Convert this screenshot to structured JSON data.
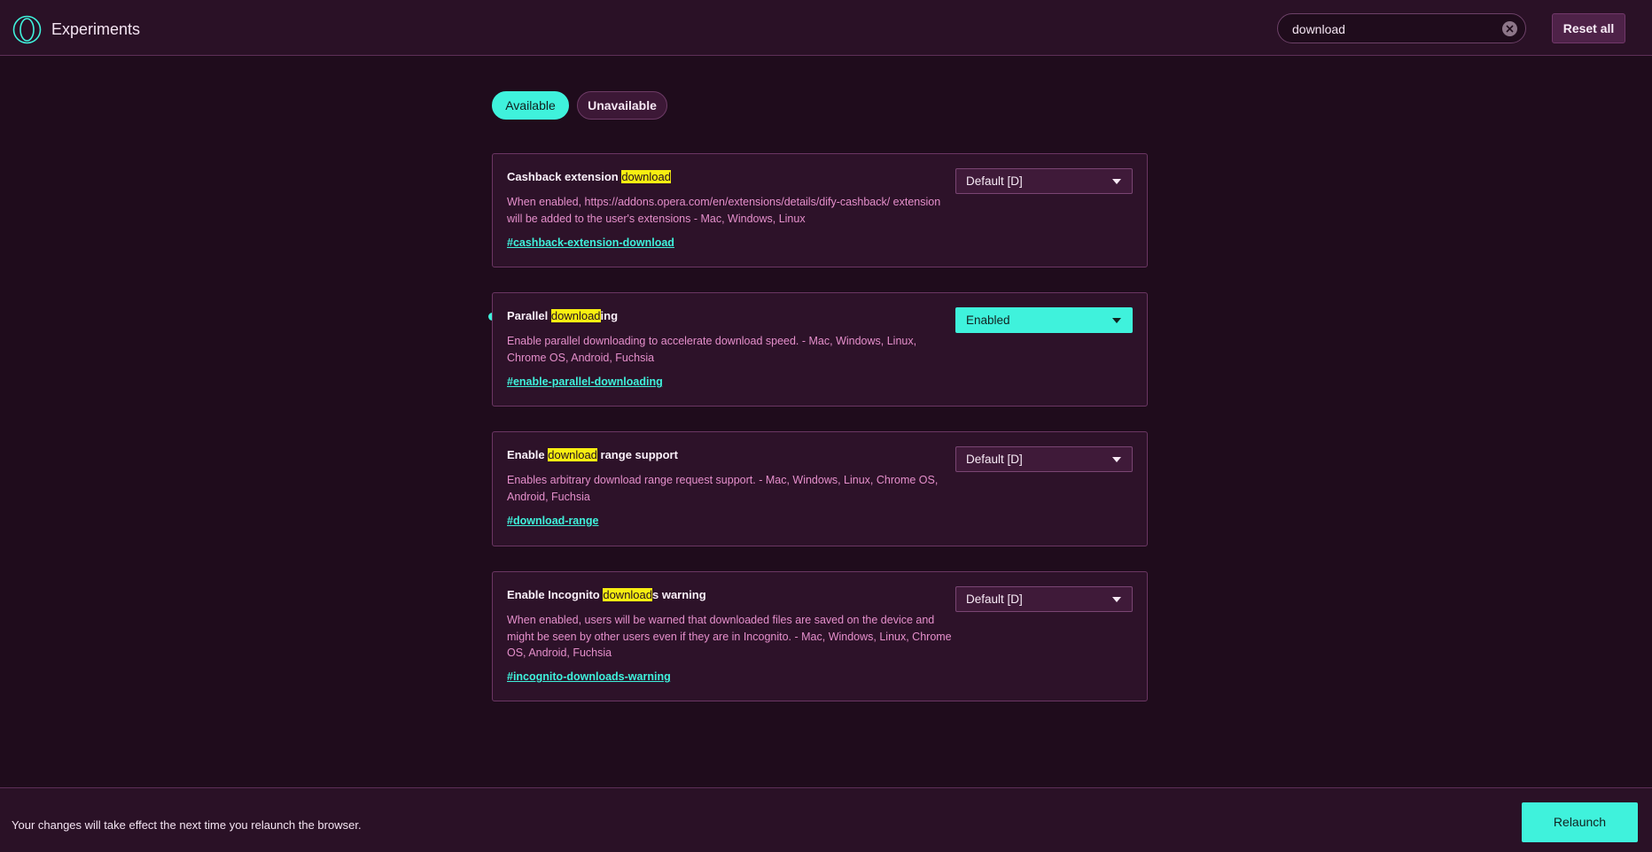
{
  "header": {
    "logo_icon": "opera-logo-icon",
    "title": "Experiments",
    "search": {
      "value": "download",
      "clear_icon": "clear-circle-icon"
    },
    "reset_label": "Reset all"
  },
  "tabs": [
    {
      "label": "Available",
      "active": true
    },
    {
      "label": "Unavailable",
      "active": false
    }
  ],
  "experiments": [
    {
      "title_before": "Cashback extension ",
      "title_match": "download",
      "title_after": "",
      "description": "When enabled, https://addons.opera.com/en/extensions/details/dify-cashback/ extension will be added to the user's extensions - Mac, Windows, Linux",
      "link": "#cashback-extension-download",
      "selected": "Default [D]",
      "modified": false
    },
    {
      "title_before": "Parallel ",
      "title_match": "download",
      "title_after": "ing",
      "description": "Enable parallel downloading to accelerate download speed. - Mac, Windows, Linux, Chrome OS, Android, Fuchsia",
      "link": "#enable-parallel-downloading",
      "selected": "Enabled",
      "modified": true
    },
    {
      "title_before": "Enable ",
      "title_match": "download",
      "title_after": " range support",
      "description": "Enables arbitrary download range request support. - Mac, Windows, Linux, Chrome OS, Android, Fuchsia",
      "link": "#download-range",
      "selected": "Default [D]",
      "modified": false
    },
    {
      "title_before": "Enable Incognito ",
      "title_match": "download",
      "title_after": "s warning",
      "description": "When enabled, users will be warned that downloaded files are saved on the device and might be seen by other users even if they are in Incognito. - Mac, Windows, Linux, Chrome OS, Android, Fuchsia",
      "link": "#incognito-downloads-warning",
      "selected": "Default [D]",
      "modified": false
    }
  ],
  "footer": {
    "message": "Your changes will take effect the next time you relaunch the browser.",
    "relaunch_label": "Relaunch"
  },
  "colors": {
    "background": "#1f0c1c",
    "accent": "#3ff2dc",
    "highlight": "#f7ee11",
    "description_text": "#e58fcb"
  }
}
